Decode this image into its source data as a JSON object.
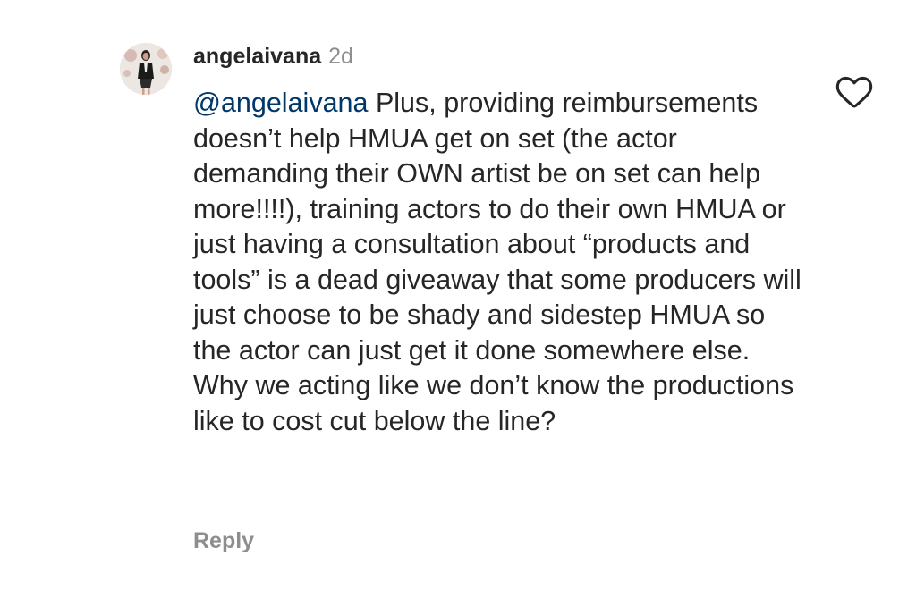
{
  "comment": {
    "username": "angelaivana",
    "timestamp": "2d",
    "mention": "@angelaivana",
    "text": " Plus, providing reimbursements doesn’t help HMUA get on set (the actor demanding their OWN artist be on set can help more!!!!), training actors to do their own HMUA or just having a consultation about “products and tools” is a dead giveaway that some producers will just choose to be shady and sidestep HMUA so the actor can just get it done somewhere else. Why we acting like we don’t know the productions like to cost cut below the line?",
    "reply_label": "Reply",
    "like_icon": "heart-outline-icon",
    "avatar_icon": "profile-avatar"
  },
  "colors": {
    "username": "#262626",
    "secondary": "#8e8e8e",
    "mention": "#00376b",
    "background": "#ffffff"
  }
}
